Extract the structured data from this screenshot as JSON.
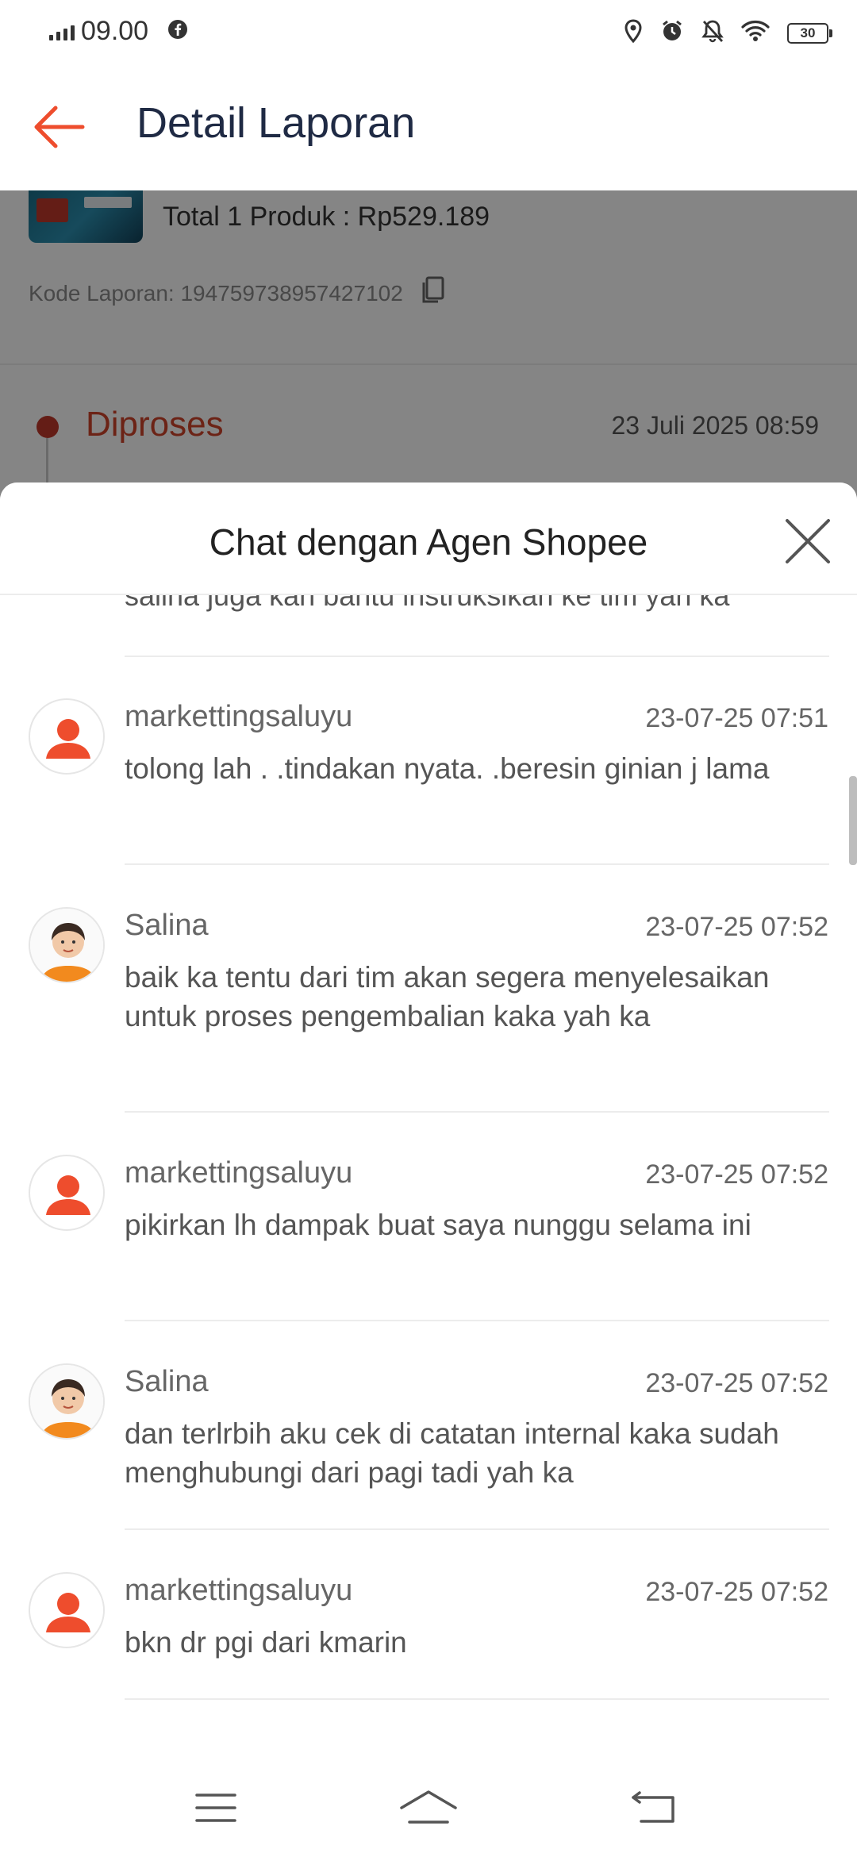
{
  "status_bar": {
    "time": "09.00",
    "battery": "30"
  },
  "app_bar": {
    "title": "Detail Laporan"
  },
  "background_page": {
    "product_total": "Total 1 Produk : Rp529.189",
    "report_code": "Kode Laporan: 194759738957427102",
    "status_label": "Diproses",
    "status_time": "23 Juli 2025 08:59"
  },
  "chat_sheet": {
    "title": "Chat dengan Agen Shopee",
    "partial_text": "salina juga kan bantu instruksikan ke tim yah ka",
    "messages": [
      {
        "sender": "markettingsaluyu",
        "time": "23-07-25 07:51",
        "text": "tolong lah . .tindakan nyata. .beresin ginian j lama",
        "avatar": "user-avatar-icon"
      },
      {
        "sender": "Salina",
        "time": "23-07-25 07:52",
        "text": "baik ka tentu dari tim akan segera menyelesaikan untuk proses pengembalian kaka yah ka",
        "avatar": "agent-avatar"
      },
      {
        "sender": "markettingsaluyu",
        "time": "23-07-25 07:52",
        "text": "pikirkan lh dampak buat saya nunggu selama ini",
        "avatar": "user-avatar-icon"
      },
      {
        "sender": "Salina",
        "time": "23-07-25 07:52",
        "text": "dan terlrbih aku cek di catatan internal kaka sudah menghubungi dari pagi tadi yah ka",
        "avatar": "agent-avatar"
      },
      {
        "sender": "markettingsaluyu",
        "time": "23-07-25 07:52",
        "text": "bkn dr pgi dari kmarin",
        "avatar": "user-avatar-icon"
      }
    ]
  },
  "colors": {
    "accent": "#ee4d2d",
    "title": "#1f2a44",
    "status": "#d0432b"
  }
}
